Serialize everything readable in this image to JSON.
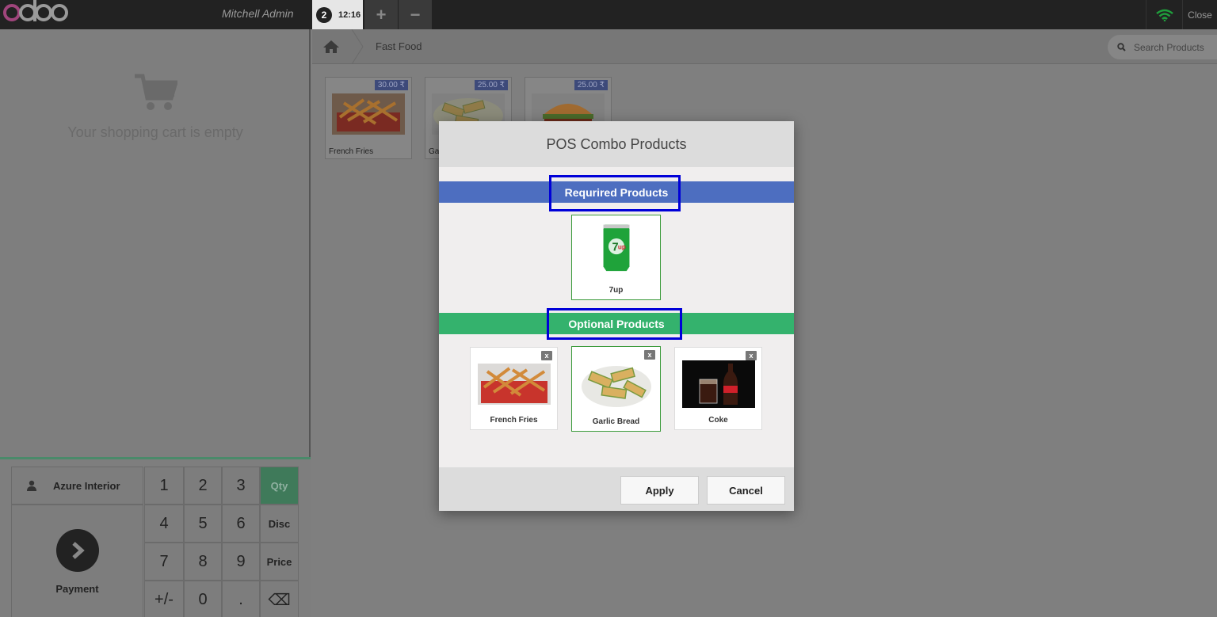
{
  "topbar": {
    "user": "Mitchell Admin",
    "order_number": "2",
    "order_time": "12:16",
    "add_icon": "plus-icon",
    "remove_icon": "minus-icon",
    "wifi_icon": "wifi-icon",
    "close_label": "Close",
    "colors": {
      "bar": "#222222",
      "wifi": "#1f9e3c",
      "logo_accent": "#a0457c"
    }
  },
  "cart": {
    "empty_message": "Your shopping cart is empty",
    "icon": "shopping-cart-icon"
  },
  "actions": {
    "customer_label": "Azure Interior",
    "customer_icon": "user-icon",
    "payment_label": "Payment",
    "payment_icon": "chevron-right-icon"
  },
  "numpad": {
    "keys": [
      "1",
      "2",
      "3",
      "Qty",
      "4",
      "5",
      "6",
      "Disc",
      "7",
      "8",
      "9",
      "Price",
      "+/-",
      "0",
      ".",
      "⌫"
    ],
    "active_mode": "Qty"
  },
  "products_screen": {
    "home_icon": "home-icon",
    "category": "Fast Food",
    "search_placeholder": "Search Products",
    "products": [
      {
        "name": "French Fries",
        "price": "30.00 ₹",
        "image": "fries"
      },
      {
        "name": "Gar",
        "price": "25.00 ₹",
        "image": "garlic-bread"
      },
      {
        "name": "",
        "price": "25.00 ₹",
        "image": "burger"
      }
    ]
  },
  "modal": {
    "title": "POS Combo Products",
    "required_label": "Requrired Products",
    "optional_label": "Optional Products",
    "required_products": [
      {
        "name": "7up",
        "image": "7up-can",
        "selected": true
      }
    ],
    "optional_products": [
      {
        "name": "French Fries",
        "image": "fries",
        "selected": false,
        "remove_label": "x"
      },
      {
        "name": "Garlic Bread",
        "image": "garlic-bread",
        "selected": true,
        "remove_label": "x"
      },
      {
        "name": "Coke",
        "image": "coke",
        "selected": false,
        "remove_label": "x"
      }
    ],
    "apply_label": "Apply",
    "cancel_label": "Cancel",
    "colors": {
      "required_bar": "#4d6ec0",
      "optional_bar": "#34b26d",
      "highlight": "#0000d8",
      "selected_border": "#3a9a3a"
    }
  }
}
